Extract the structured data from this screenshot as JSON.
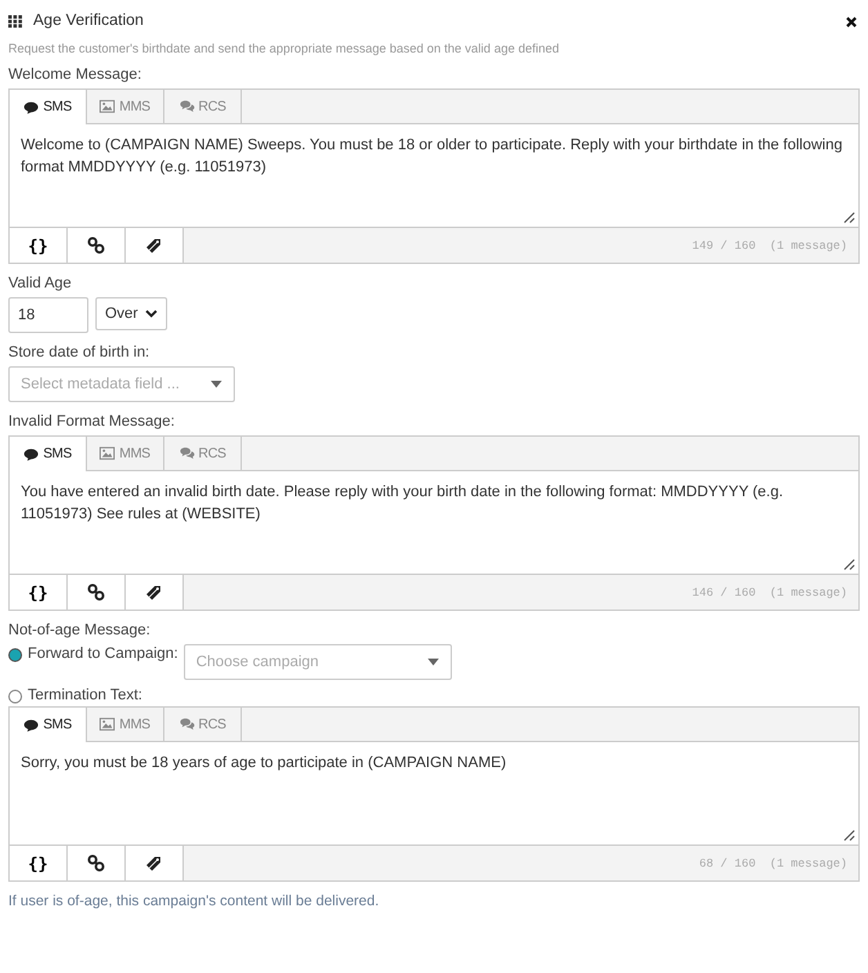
{
  "window": {
    "title": "Age Verification",
    "description": "Request the customer's birthdate and send the appropriate message based on the valid age defined"
  },
  "welcome": {
    "label": "Welcome Message:",
    "editor": {
      "tabs": [
        {
          "label": "SMS",
          "selected": true
        },
        {
          "label": "MMS",
          "selected": false
        },
        {
          "label": "RCS",
          "selected": false
        }
      ],
      "text": "Welcome to (CAMPAIGN NAME) Sweeps. You must be 18 or older to participate. Reply with your birthdate in the following format MMDDYYYY (e.g. 11051973)",
      "variable_button": "{}",
      "counter": "149 / 160  (1 message)"
    }
  },
  "valid_age": {
    "label": "Valid Age",
    "value": "18",
    "comparison": "Over"
  },
  "store_dob": {
    "label": "Store date of birth in:",
    "placeholder": "Select metadata field ..."
  },
  "invalid_format": {
    "label": "Invalid Format Message:",
    "editor": {
      "tabs": [
        {
          "label": "SMS",
          "selected": true
        },
        {
          "label": "MMS",
          "selected": false
        },
        {
          "label": "RCS",
          "selected": false
        }
      ],
      "text": "You have entered an invalid birth date. Please reply with your birth date in the following format: MMDDYYYY (e.g. 11051973) See rules at (WEBSITE)",
      "variable_button": "{}",
      "counter": "146 / 160  (1 message)"
    }
  },
  "not_of_age": {
    "label": "Not-of-age Message:",
    "options": [
      {
        "label": "Forward to Campaign:",
        "selected": true,
        "placeholder": "Choose campaign"
      },
      {
        "label": "Termination Text:",
        "selected": false
      }
    ],
    "editor": {
      "tabs": [
        {
          "label": "SMS",
          "selected": true
        },
        {
          "label": "MMS",
          "selected": false
        },
        {
          "label": "RCS",
          "selected": false
        }
      ],
      "text": "Sorry, you must be 18 years of age to participate in (CAMPAIGN NAME)",
      "variable_button": "{}",
      "counter": "68 / 160  (1 message)"
    }
  },
  "footer_note": "If user is of-age, this campaign's content will be delivered."
}
